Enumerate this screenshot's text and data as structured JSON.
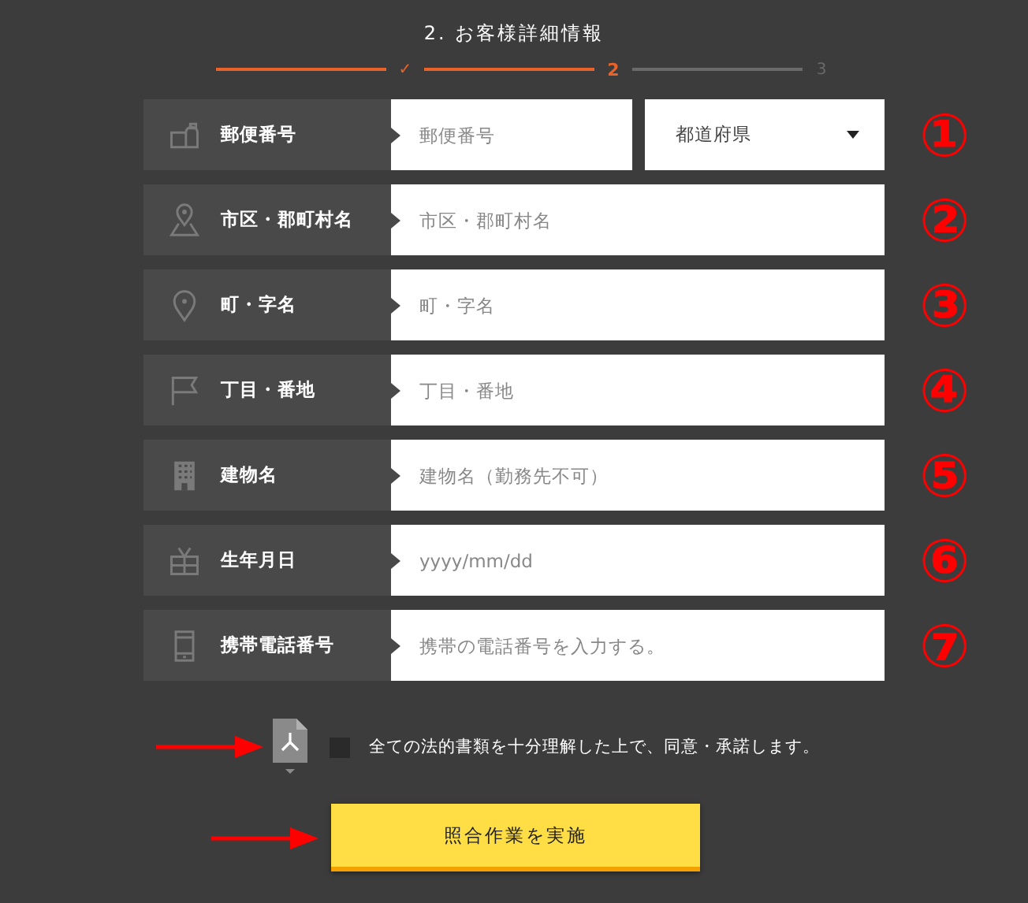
{
  "title": "2. お客様詳細情報",
  "steps": [
    {
      "label": "✓",
      "done": true,
      "selected": false
    },
    {
      "label": "2",
      "done": false,
      "selected": true
    },
    {
      "label": "3",
      "done": false,
      "selected": false
    }
  ],
  "rows": [
    {
      "label": "郵便番号",
      "placeholder": "郵便番号",
      "select": "都道府県",
      "annotation": "①"
    },
    {
      "label": "市区・郡町村名",
      "placeholder": "市区・郡町村名",
      "annotation": "②"
    },
    {
      "label": "町・字名",
      "placeholder": "町・字名",
      "annotation": "③"
    },
    {
      "label": "丁目・番地",
      "placeholder": "丁目・番地",
      "annotation": "④"
    },
    {
      "label": "建物名",
      "placeholder": "建物名（勤務先不可）",
      "annotation": "⑤"
    },
    {
      "label": "生年月日",
      "placeholder": "yyyy/mm/dd",
      "annotation": "⑥"
    },
    {
      "label": "携帯電話番号",
      "placeholder": "携帯の電話番号を入力する。",
      "annotation": "⑦"
    }
  ],
  "agreement": {
    "checked": false,
    "text": "全ての法的書類を十分理解した上で、同意・承諾します。"
  },
  "submit": "照合作業を実施"
}
